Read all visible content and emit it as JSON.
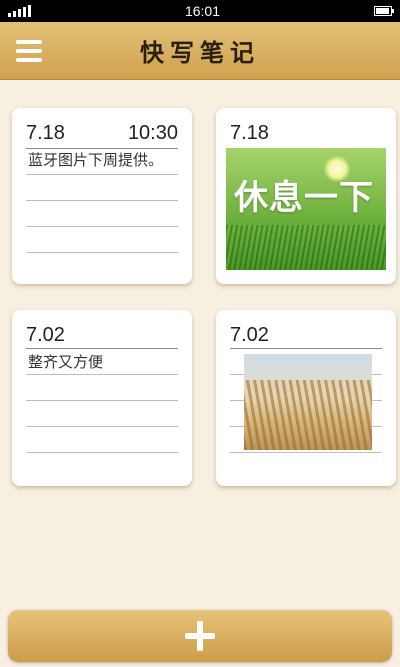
{
  "status_bar": {
    "time": "16:01",
    "battery_level": 0.9
  },
  "header": {
    "title": "快写笔记",
    "menu_icon": "hamburger-menu-icon"
  },
  "notes": [
    {
      "date": "7.18",
      "time": "10:30",
      "text": "蓝牙图片下周提供。",
      "type": "text"
    },
    {
      "date": "7.18",
      "type": "image",
      "image": "grass-field",
      "image_text": "休息一下"
    },
    {
      "date": "7.02",
      "text": "整齐又方便",
      "type": "text"
    },
    {
      "date": "7.02",
      "type": "image",
      "image": "wheat-field"
    }
  ],
  "add_button": {
    "icon": "plus-icon"
  },
  "colors": {
    "header": "#d8b062",
    "background": "#f7efe0",
    "card": "#ffffff"
  }
}
